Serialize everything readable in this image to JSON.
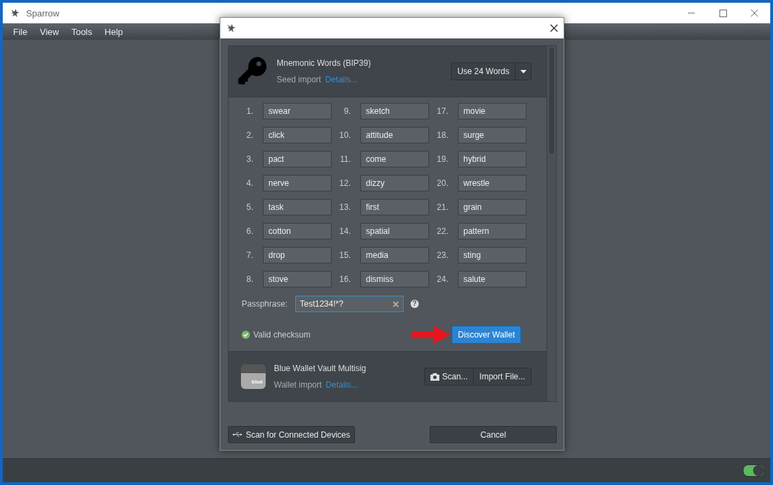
{
  "window": {
    "title": "Sparrow"
  },
  "menu": [
    "File",
    "View",
    "Tools",
    "Help"
  ],
  "dialog": {
    "mnemonic": {
      "title": "Mnemonic Words (BIP39)",
      "subtitle": "Seed import",
      "details_link": "Details...",
      "word_count_button": "Use 24 Words",
      "words": [
        {
          "number": "1.",
          "word": "swear"
        },
        {
          "number": "2.",
          "word": "click"
        },
        {
          "number": "3.",
          "word": "pact"
        },
        {
          "number": "4.",
          "word": "nerve"
        },
        {
          "number": "5.",
          "word": "task"
        },
        {
          "number": "6.",
          "word": "cotton"
        },
        {
          "number": "7.",
          "word": "drop"
        },
        {
          "number": "8.",
          "word": "stove"
        },
        {
          "number": "9.",
          "word": "sketch"
        },
        {
          "number": "10.",
          "word": "attitude"
        },
        {
          "number": "11.",
          "word": "come"
        },
        {
          "number": "12.",
          "word": "dizzy"
        },
        {
          "number": "13.",
          "word": "first"
        },
        {
          "number": "14.",
          "word": "spatial"
        },
        {
          "number": "15.",
          "word": "media"
        },
        {
          "number": "16.",
          "word": "dismiss"
        },
        {
          "number": "17.",
          "word": "movie"
        },
        {
          "number": "18.",
          "word": "surge"
        },
        {
          "number": "19.",
          "word": "hybrid"
        },
        {
          "number": "20.",
          "word": "wrestle"
        },
        {
          "number": "21.",
          "word": "grain"
        },
        {
          "number": "22.",
          "word": "pattern"
        },
        {
          "number": "23.",
          "word": "sting"
        },
        {
          "number": "24.",
          "word": "salute"
        }
      ],
      "passphrase_label": "Passphrase:",
      "help_icon": "?",
      "passphrase_value": "Test1234!*?",
      "checksum": {
        "text": "Valid checksum",
        "valid": true
      },
      "discover_button": "Discover Wallet"
    },
    "blue_wallet": {
      "title": "Blue Wallet Vault Multisig",
      "subtitle": "Wallet import",
      "details_link": "Details...",
      "logo_text": "blue",
      "buttons": [
        "Scan...",
        "Import File..."
      ]
    },
    "scan_button": "Scan for Connected Devices",
    "cancel_button": "Cancel"
  },
  "status_bar": {
    "toggle_on": true
  }
}
